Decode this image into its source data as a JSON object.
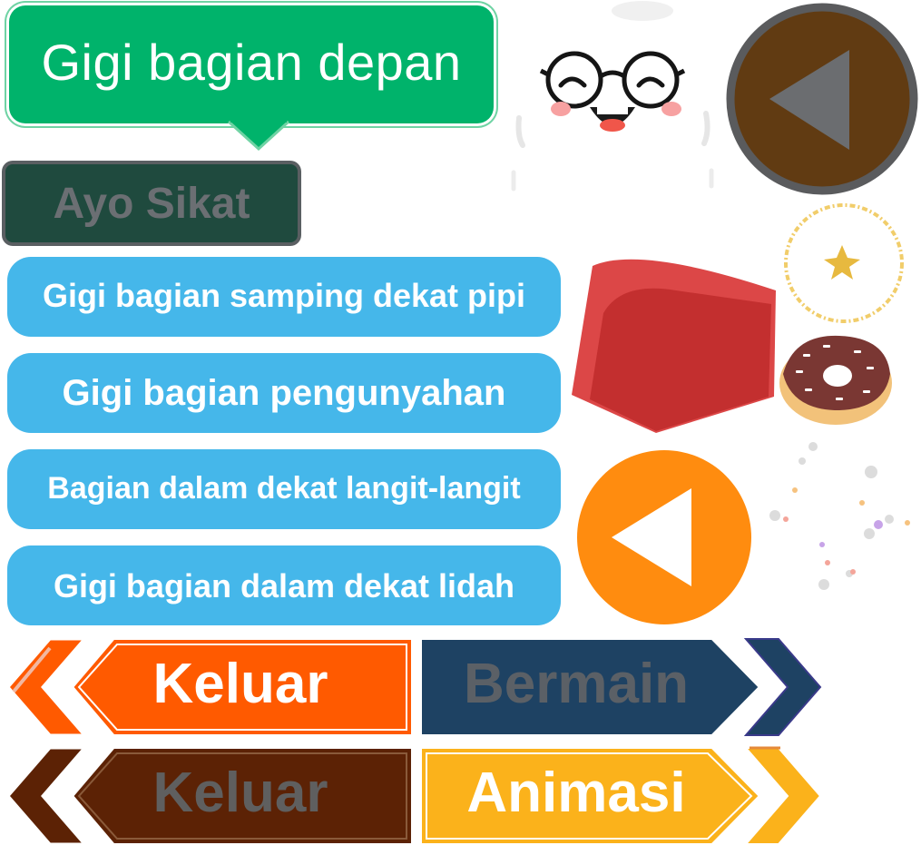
{
  "bubble": {
    "label": "Gigi bagian depan"
  },
  "ayo_button": {
    "label": "Ayo Sikat"
  },
  "options": [
    {
      "label": "Gigi bagian samping dekat pipi"
    },
    {
      "label": "Gigi bagian pengunyahan"
    },
    {
      "label": "Bagian dalam dekat langit-langit"
    },
    {
      "label": "Gigi bagian dalam dekat lidah"
    }
  ],
  "nav_buttons": {
    "keluar_active": "Keluar",
    "bermain": "Bermain",
    "keluar_inactive": "Keluar",
    "animasi": "Animasi"
  },
  "icons": {
    "back_brown": "play-left-icon",
    "back_orange": "play-left-icon",
    "mascot": "tooth-mascot-icon",
    "hat": "red-hat-icon",
    "donut": "donut-icon",
    "sparkle": "sparkle-star-icon"
  },
  "colors": {
    "green": "#00b36b",
    "dark_green": "#1f4a3e",
    "blue": "#45b7ea",
    "orange": "#ff5a00",
    "navy": "#1e4263",
    "brown": "#5c2205",
    "gold": "#fbb21b",
    "circle_orange": "#ff8c0f",
    "circle_brown": "#613b12"
  }
}
